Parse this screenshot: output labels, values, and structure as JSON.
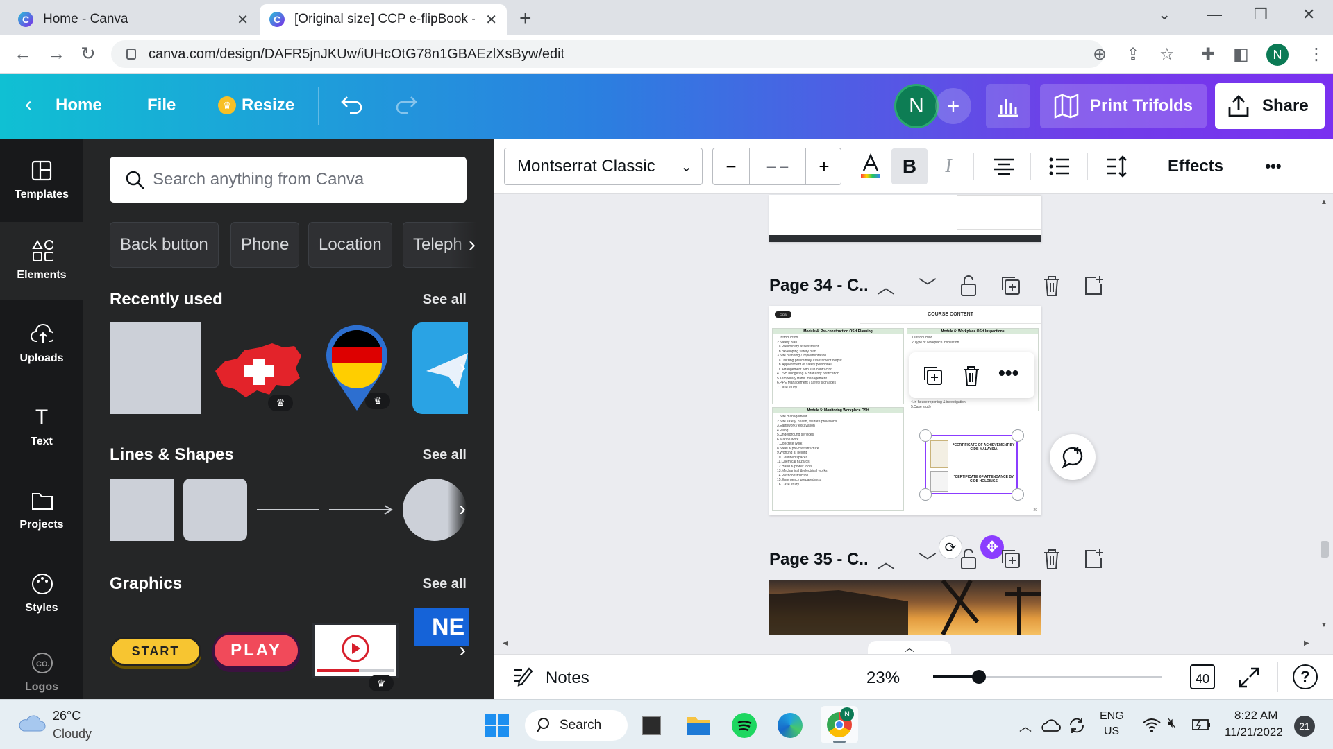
{
  "browser": {
    "tabs": [
      {
        "title": "Home - Canva"
      },
      {
        "title": "[Original size] CCP e-flipBook - Tr"
      }
    ],
    "url": "canva.com/design/DAFR5jnJKUw/iUHcOtG78n1GBAEzlXsByw/edit",
    "profile_initial": "N"
  },
  "topbar": {
    "home": "Home",
    "file": "File",
    "resize": "Resize",
    "avatar_initial": "N",
    "print_label": "Print Trifolds",
    "share_label": "Share"
  },
  "rail": [
    {
      "label": "Templates",
      "icon": "templates-icon"
    },
    {
      "label": "Elements",
      "icon": "elements-icon"
    },
    {
      "label": "Uploads",
      "icon": "uploads-icon"
    },
    {
      "label": "Text",
      "icon": "text-icon"
    },
    {
      "label": "Projects",
      "icon": "projects-icon"
    },
    {
      "label": "Styles",
      "icon": "styles-icon"
    },
    {
      "label": "Logos",
      "icon": "logos-icon"
    }
  ],
  "panel": {
    "search_placeholder": "Search anything from Canva",
    "chips": [
      "Back button",
      "Phone",
      "Location",
      "Teleph"
    ],
    "recently_used": "Recently used",
    "lines_shapes": "Lines & Shapes",
    "graphics": "Graphics",
    "see_all": "See all",
    "graphic_labels": {
      "start": "START",
      "play": "PLAY",
      "next": "NE"
    }
  },
  "format": {
    "font": "Montserrat Classic",
    "size": "– –",
    "effects": "Effects"
  },
  "pages": {
    "p34_title": "Page 34 - C..",
    "p35_title": "Page 35 - C..",
    "course_content": "COURSE CONTENT",
    "module4": "Module 4: Pre-construction OSH Planning",
    "module6": "Module 6: Workplace OSH Inspections",
    "module5": "Module 5: Monitoring Workplace OSH",
    "cert1": "*CERTIFICATE OF ACHIEVEMENT BY CIDB MALAYSIA",
    "cert2": "*CERTIFICATE OF ATTENDANCE BY CIDB HOLDINGS",
    "page_num": "29",
    "logo_text": "CIDB"
  },
  "bottom": {
    "notes": "Notes",
    "zoom": "23%",
    "zoom_fraction": 0.2,
    "page_count": "40"
  },
  "taskbar": {
    "temp": "26°C",
    "weather": "Cloudy",
    "search": "Search",
    "lang1": "ENG",
    "lang2": "US",
    "time": "8:22 AM",
    "date": "11/21/2022",
    "notif": "21"
  },
  "colors": {
    "accent_purple": "#8b3dff",
    "panel_bg": "#252627",
    "rail_bg": "#18191b"
  }
}
